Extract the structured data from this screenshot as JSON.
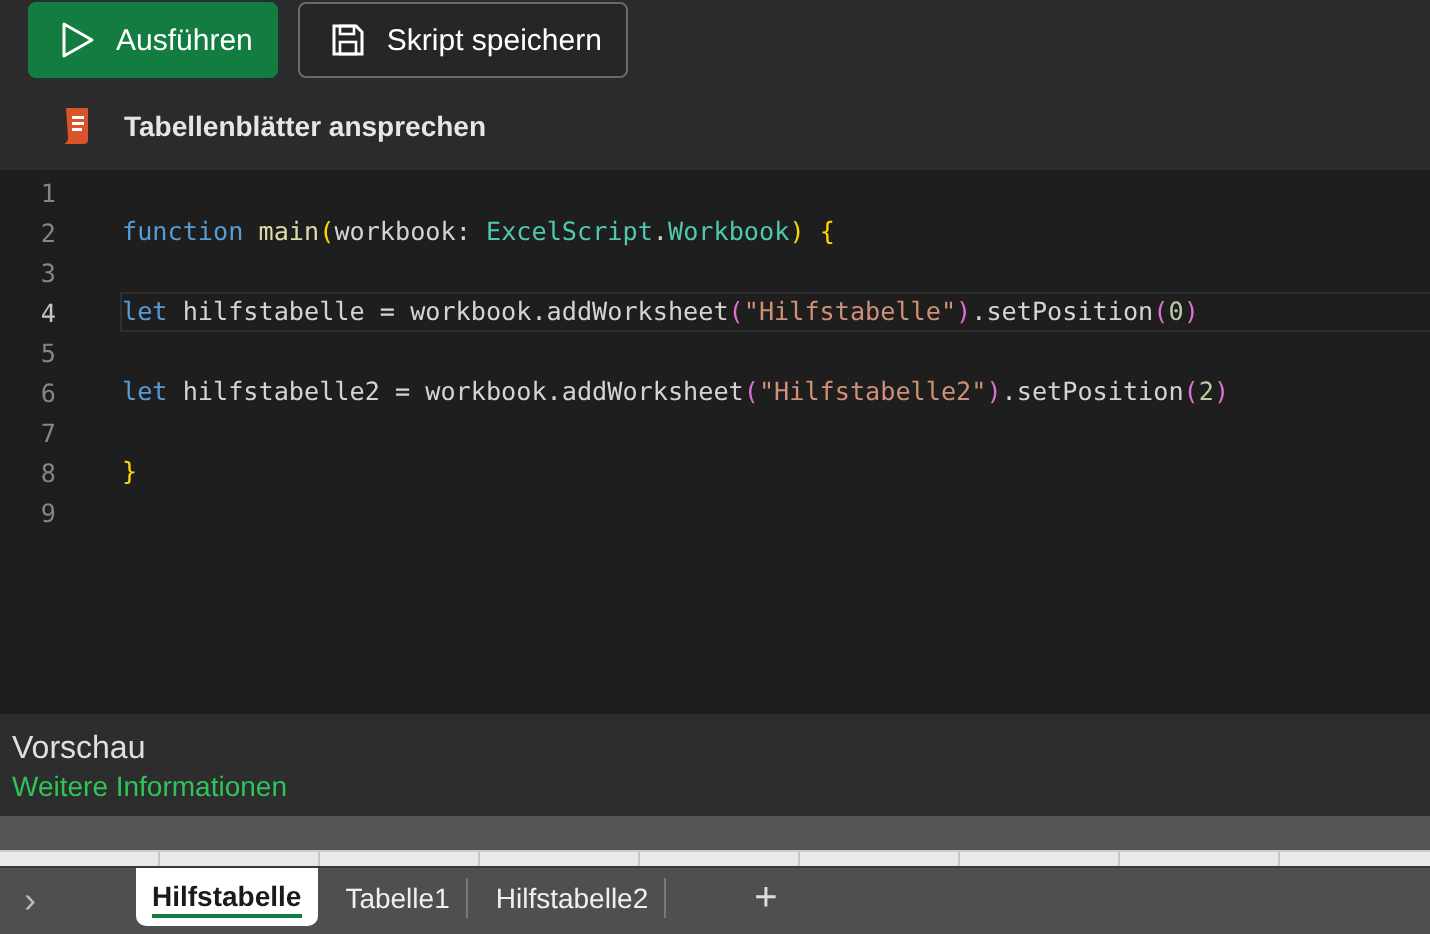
{
  "toolbar": {
    "buttons": [
      {
        "label": "Ausführen",
        "kind": "run"
      },
      {
        "label": "Skript speichern",
        "kind": "save"
      }
    ]
  },
  "script": {
    "title": "Tabellenblätter ansprechen"
  },
  "editor": {
    "lines": [
      {
        "number": "1",
        "current": false
      },
      {
        "number": "2",
        "current": false,
        "tokens": [
          {
            "text": "function ",
            "kind": "keyword"
          },
          {
            "text": "main",
            "kind": "func"
          },
          {
            "text": "(",
            "kind": "bracket1"
          },
          {
            "text": "workbook: ",
            "kind": "plain"
          },
          {
            "text": "ExcelScript",
            "kind": "type"
          },
          {
            "text": ".",
            "kind": "plain"
          },
          {
            "text": "Workbook",
            "kind": "type"
          },
          {
            "text": ")",
            "kind": "bracket1"
          },
          {
            "text": " {",
            "kind": "bracket1"
          }
        ]
      },
      {
        "number": "3",
        "current": false
      },
      {
        "number": "4",
        "current": true,
        "tokens": [
          {
            "text": "let",
            "kind": "keyword"
          },
          {
            "text": " hilfstabelle = workbook.addWorksheet",
            "kind": "plain"
          },
          {
            "text": "(",
            "kind": "bracket2"
          },
          {
            "text": "\"Hilfstabelle\"",
            "kind": "string"
          },
          {
            "text": ")",
            "kind": "bracket2"
          },
          {
            "text": ".setPosition",
            "kind": "plain"
          },
          {
            "text": "(",
            "kind": "bracket2"
          },
          {
            "text": "0",
            "kind": "number"
          },
          {
            "text": ")",
            "kind": "bracket2"
          }
        ]
      },
      {
        "number": "5",
        "current": false
      },
      {
        "number": "6",
        "current": false,
        "tokens": [
          {
            "text": "let",
            "kind": "keyword"
          },
          {
            "text": " hilfstabelle2 = workbook.addWorksheet",
            "kind": "plain"
          },
          {
            "text": "(",
            "kind": "bracket2"
          },
          {
            "text": "\"Hilfstabelle2\"",
            "kind": "string"
          },
          {
            "text": ")",
            "kind": "bracket2"
          },
          {
            "text": ".setPosition",
            "kind": "plain"
          },
          {
            "text": "(",
            "kind": "bracket2"
          },
          {
            "text": "2",
            "kind": "number"
          },
          {
            "text": ")",
            "kind": "bracket2"
          }
        ]
      },
      {
        "number": "7",
        "current": false
      },
      {
        "number": "8",
        "current": false,
        "tokens": [
          {
            "text": "}",
            "kind": "bracket1"
          }
        ]
      },
      {
        "number": "9",
        "current": false
      }
    ]
  },
  "preview": {
    "title": "Vorschau",
    "link": "Weitere Informationen"
  },
  "sheet_tabs": {
    "scroll": "›",
    "tabs": [
      {
        "label": "Hilfstabelle",
        "selected": true
      },
      {
        "label": "Tabelle1",
        "selected": false
      },
      {
        "label": "Hilfstabelle2",
        "selected": false
      }
    ],
    "add": "+"
  }
}
